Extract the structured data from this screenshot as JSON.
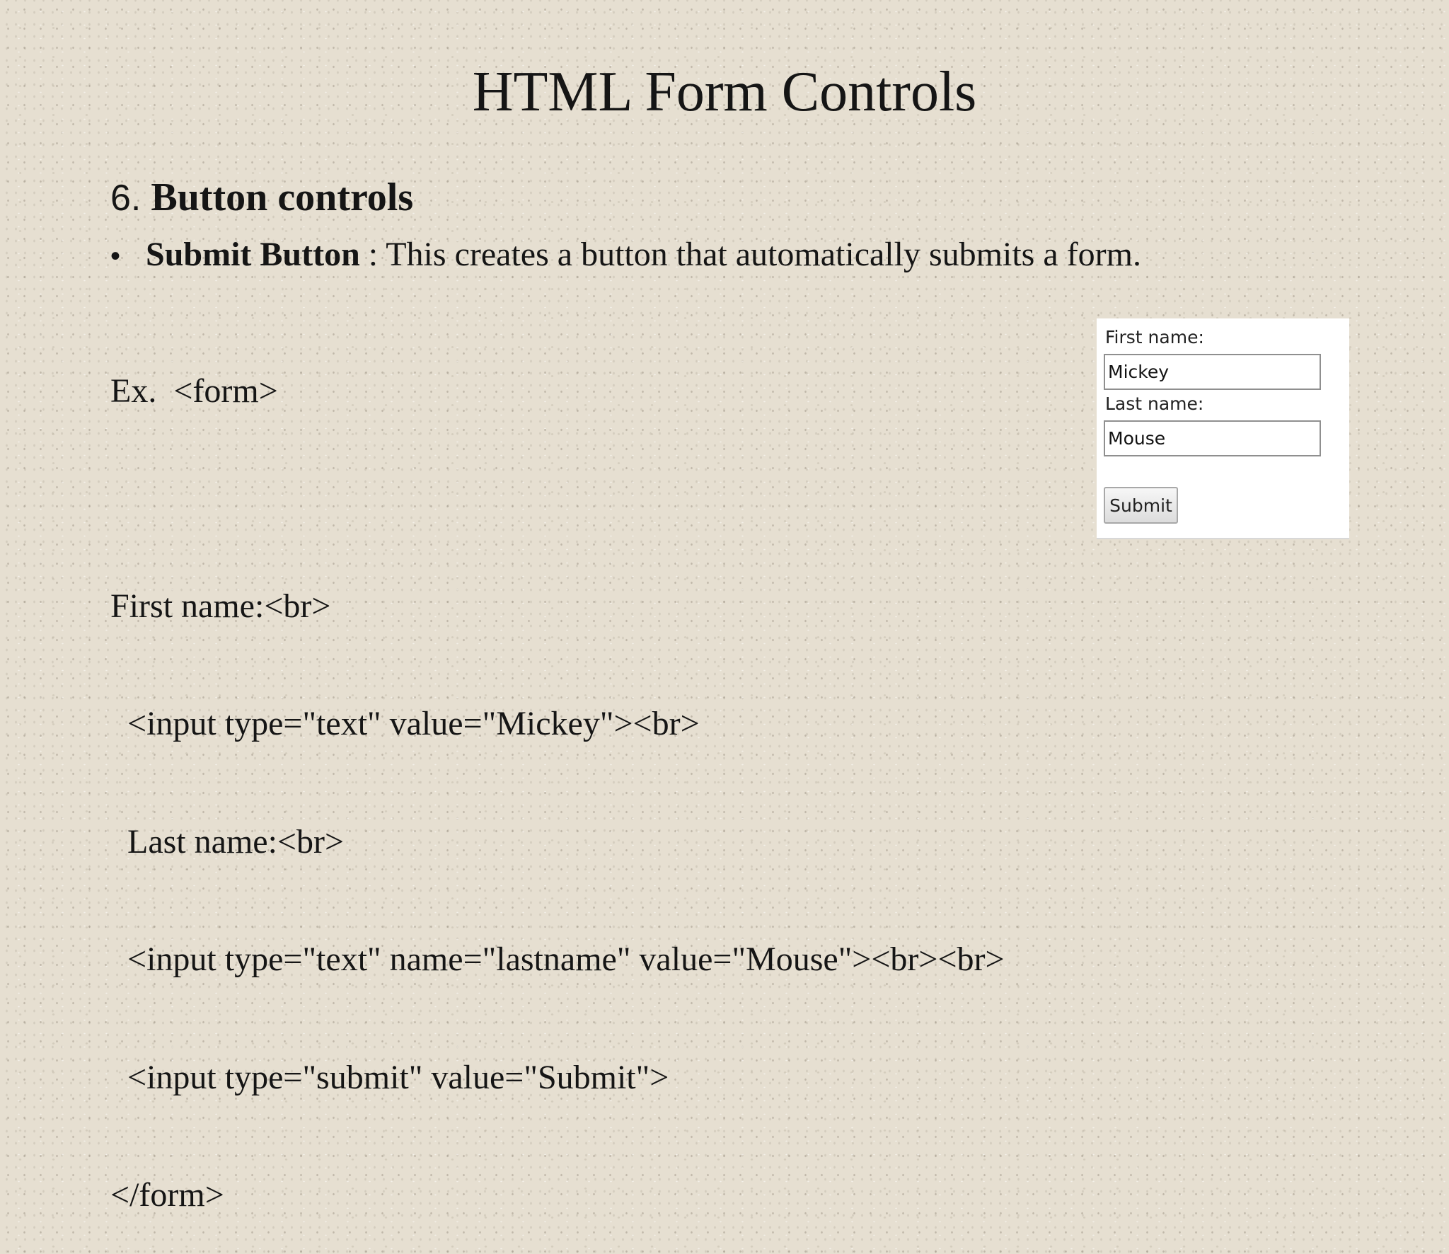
{
  "slide": {
    "title": "HTML Form Controls",
    "section_number": "6.",
    "section_title": "Button controls",
    "bullet": {
      "symbol": "•",
      "term": "Submit Button",
      "description": " : This creates a button that automatically submits a form."
    },
    "code_lines": [
      "Ex.  <form>",
      "First name:<br>",
      "  <input type=\"text\" value=\"Mickey\"><br>",
      "  Last name:<br>",
      "  <input type=\"text\" name=\"lastname\" value=\"Mouse\"><br><br>",
      "  <input type=\"submit\" value=\"Submit\">",
      "</form>"
    ]
  },
  "preview": {
    "first_name_label": "First name:",
    "first_name_value": "Mickey",
    "last_name_label": "Last name:",
    "last_name_value": "Mouse",
    "submit_label": "Submit"
  }
}
